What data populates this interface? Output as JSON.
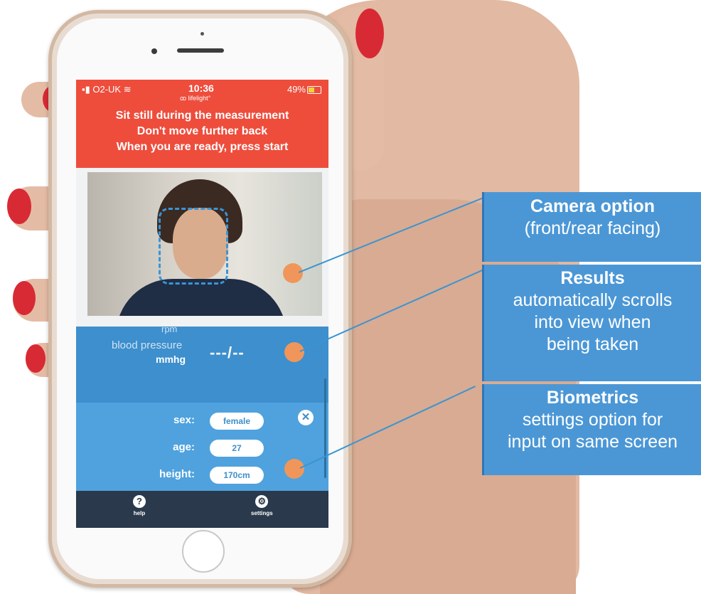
{
  "status_bar": {
    "carrier": "O2-UK",
    "time": "10:36",
    "battery": "49%",
    "app_logo_text": "lifelight"
  },
  "instructions": {
    "line1": "Sit still during the measurement",
    "line2": "Don't move further back",
    "line3": "When you are ready, press start"
  },
  "results": {
    "rpm_label": "rpm",
    "bp_label": "blood pressure",
    "bp_unit": "mmhg",
    "bp_value": "---/--"
  },
  "biometrics": {
    "sex_label": "sex:",
    "sex_value": "female",
    "age_label": "age:",
    "age_value": "27",
    "height_label": "height:",
    "height_value": "170cm",
    "close_icon": "close-icon"
  },
  "tab_bar": {
    "help_label": "help",
    "help_icon": "help-icon",
    "settings_label": "settings",
    "settings_icon": "gear-icon"
  },
  "callouts": {
    "camera_title": "Camera option",
    "camera_text": "(front/rear facing)",
    "results_title": "Results",
    "results_line1": "automatically scrolls",
    "results_line2": "into view when",
    "results_line3": "being taken",
    "biometrics_title": "Biometrics",
    "biometrics_line1": "settings option for",
    "biometrics_line2": "input on same screen"
  },
  "colors": {
    "header_red": "#ee4d3c",
    "app_blue": "#3d8fcd",
    "tab_dark": "#2a394b",
    "marker_orange": "#f0965a",
    "callout_blue": "#4b97d6"
  }
}
